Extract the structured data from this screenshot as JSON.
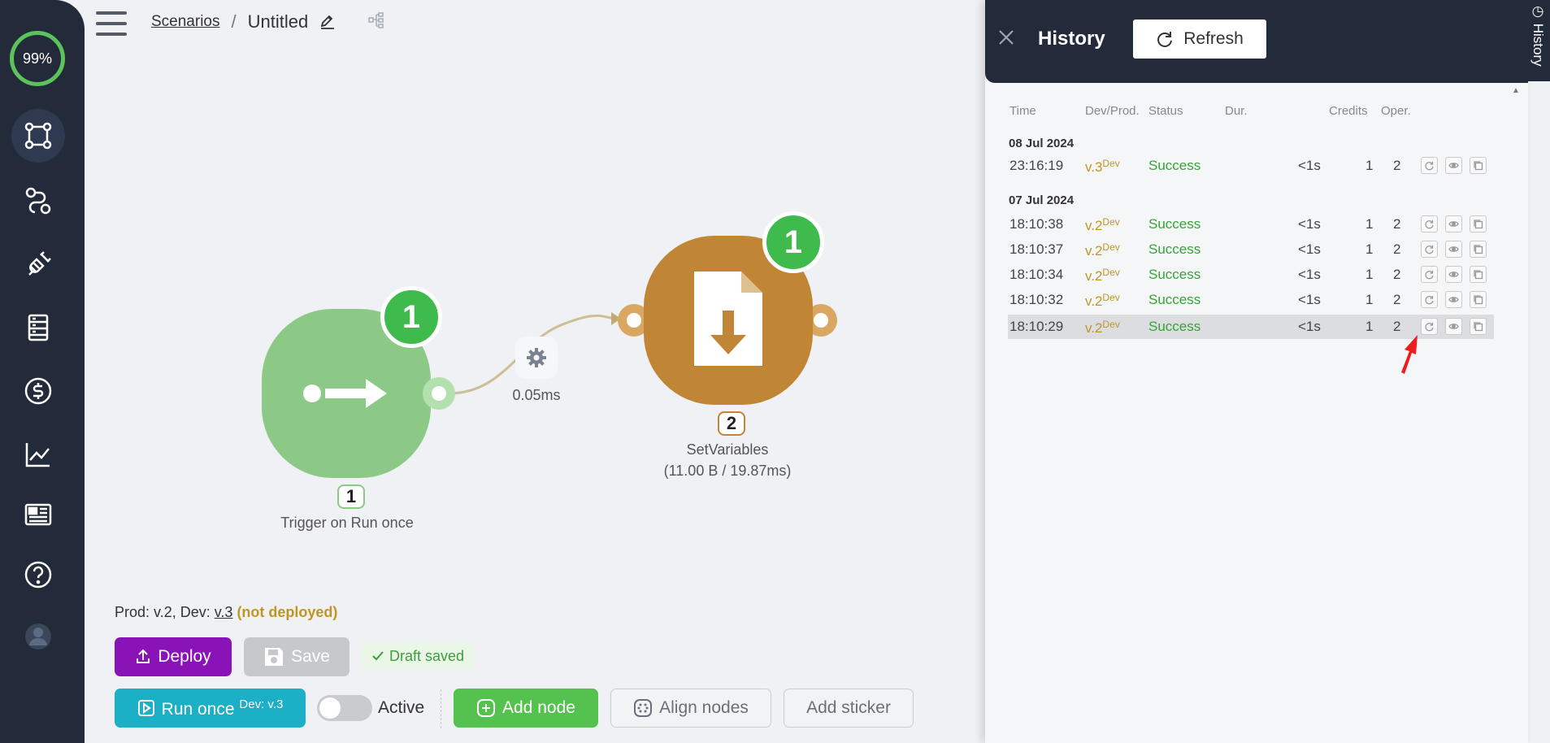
{
  "sidebar": {
    "progress": "99%",
    "items": [
      "scenarios-icon",
      "connections-icon",
      "plugins-icon",
      "datastore-icon",
      "billing-icon",
      "analytics-icon",
      "news-icon",
      "help-icon",
      "user-icon"
    ]
  },
  "header": {
    "breadcrumb_root": "Scenarios",
    "separator": "/",
    "title": "Untitled"
  },
  "canvas": {
    "trigger": {
      "badge": "1",
      "id": "1",
      "label": "Trigger on Run once"
    },
    "link": {
      "timing": "0.05ms"
    },
    "setvariables": {
      "badge": "1",
      "id": "2",
      "label": "SetVariables",
      "stats": "(11.00 B / 19.87ms)"
    }
  },
  "footer": {
    "version_prefix": "Prod: v.2, Dev:",
    "dev_version": "v.3",
    "deploy_status": "(not deployed)",
    "deploy_label": "Deploy",
    "save_label": "Save",
    "draft_label": "Draft saved",
    "run_label": "Run once",
    "run_sup": "Dev: v.3",
    "active_label": "Active",
    "add_node_label": "Add node",
    "align_label": "Align nodes",
    "sticker_label": "Add sticker"
  },
  "history": {
    "title": "History",
    "refresh_label": "Refresh",
    "tab_label": "History",
    "columns": [
      "Time",
      "Dev/Prod.",
      "Status",
      "Dur.",
      "Credits",
      "Oper."
    ],
    "groups": [
      {
        "date": "08 Jul 2024",
        "rows": [
          {
            "time": "23:16:19",
            "ver": "v.3",
            "env": "Dev",
            "status": "Success",
            "dur": "<1s",
            "credits": "1",
            "oper": "2"
          }
        ]
      },
      {
        "date": "07 Jul 2024",
        "rows": [
          {
            "time": "18:10:38",
            "ver": "v.2",
            "env": "Dev",
            "status": "Success",
            "dur": "<1s",
            "credits": "1",
            "oper": "2"
          },
          {
            "time": "18:10:37",
            "ver": "v.2",
            "env": "Dev",
            "status": "Success",
            "dur": "<1s",
            "credits": "1",
            "oper": "2"
          },
          {
            "time": "18:10:34",
            "ver": "v.2",
            "env": "Dev",
            "status": "Success",
            "dur": "<1s",
            "credits": "1",
            "oper": "2"
          },
          {
            "time": "18:10:32",
            "ver": "v.2",
            "env": "Dev",
            "status": "Success",
            "dur": "<1s",
            "credits": "1",
            "oper": "2"
          },
          {
            "time": "18:10:29",
            "ver": "v.2",
            "env": "Dev",
            "status": "Success",
            "dur": "<1s",
            "credits": "1",
            "oper": "2"
          }
        ]
      }
    ]
  },
  "colors": {
    "sidebar_bg": "#232a3a",
    "trigger_node": "#8dc986",
    "set_node": "#c08635",
    "badge": "#3fba4d",
    "deploy": "#8a13b8",
    "run": "#1bb0c5",
    "add_node": "#55c24f",
    "success": "#34a534",
    "version": "#c09623"
  }
}
